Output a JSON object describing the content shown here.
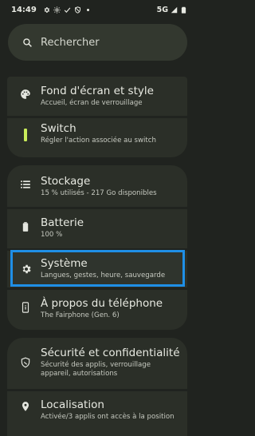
{
  "status_bar": {
    "time": "14:49",
    "network": "5G",
    "icons": [
      "gear-icon",
      "brightness-icon",
      "check-icon",
      "dnd-icon",
      "dot-icon",
      "signal-icon",
      "battery-icon"
    ]
  },
  "search": {
    "placeholder": "Rechercher"
  },
  "groups": [
    {
      "items": [
        {
          "title": "Fond d'écran et style",
          "subtitle": "Accueil, écran de verrouillage",
          "icon": "palette-icon"
        },
        {
          "title": "Switch",
          "subtitle": "Régler l'action associée au switch",
          "icon": "switch-icon"
        }
      ]
    },
    {
      "items": [
        {
          "title": "Stockage",
          "subtitle": "15 % utilisés - 217 Go disponibles",
          "icon": "storage-icon"
        },
        {
          "title": "Batterie",
          "subtitle": "100 %",
          "icon": "battery-icon"
        },
        {
          "title": "Système",
          "subtitle": "Langues, gestes, heure, sauvegarde",
          "icon": "gear-icon",
          "highlighted": true
        },
        {
          "title": "À propos du téléphone",
          "subtitle": "The Fairphone (Gen. 6)",
          "icon": "phone-info-icon"
        }
      ]
    },
    {
      "items": [
        {
          "title": "Sécurité et confidentialité",
          "subtitle": "Sécurité des applis, verrouillage appareil, autorisations",
          "icon": "shield-icon"
        },
        {
          "title": "Localisation",
          "subtitle": "Activée/3 applis ont accès à la position",
          "icon": "location-icon"
        }
      ]
    }
  ],
  "colors": {
    "accent_switch": "#c9ec5a",
    "highlight_border": "#1f8fe6"
  }
}
